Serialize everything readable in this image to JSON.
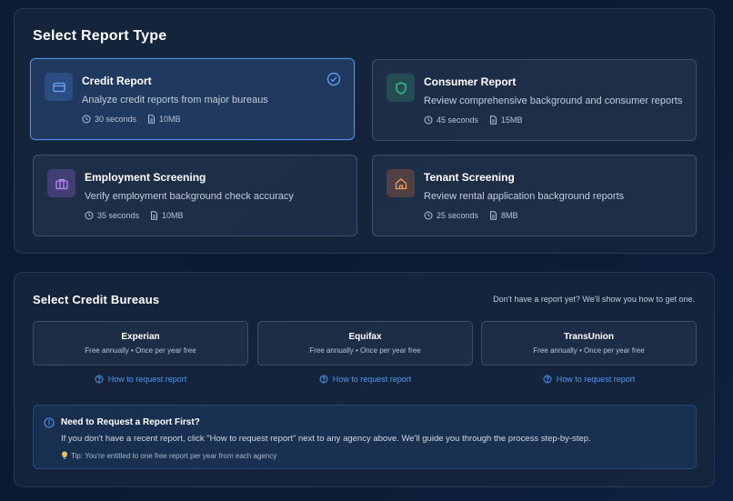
{
  "report_section": {
    "title": "Select Report Type",
    "cards": [
      {
        "title": "Credit Report",
        "desc": "Analyze credit reports from major bureaus",
        "time": "30 seconds",
        "size": "10MB",
        "icon": "credit-card-icon",
        "selected": true,
        "accent": "#5b9cf5"
      },
      {
        "title": "Consumer Report",
        "desc": "Review comprehensive background and consumer reports",
        "time": "45 seconds",
        "size": "15MB",
        "icon": "shield-icon",
        "selected": false,
        "accent": "#3ec98a"
      },
      {
        "title": "Employment Screening",
        "desc": "Verify employment background check accuracy",
        "time": "35 seconds",
        "size": "10MB",
        "icon": "briefcase-icon",
        "selected": false,
        "accent": "#b07cf0"
      },
      {
        "title": "Tenant Screening",
        "desc": "Review rental application background reports",
        "time": "25 seconds",
        "size": "8MB",
        "icon": "home-icon",
        "selected": false,
        "accent": "#f0904a"
      }
    ]
  },
  "bureau_section": {
    "title": "Select Credit Bureaus",
    "subtitle": "Don't have a report yet? We'll show you how to get one.",
    "bureaus": [
      {
        "name": "Experian",
        "sub": "Free annually • Once per year free",
        "link": "How to request report"
      },
      {
        "name": "Equifax",
        "sub": "Free annually • Once per year free",
        "link": "How to request report"
      },
      {
        "name": "TransUnion",
        "sub": "Free annually • Once per year free",
        "link": "How to request report"
      }
    ],
    "notice": {
      "title": "Need to Request a Report First?",
      "body": "If you don't have a recent report, click \"How to request report\" next to any agency above. We'll guide you through the process step-by-step.",
      "tip": "Tip: You're entitled to one free report per year from each agency"
    }
  },
  "colors": {
    "link": "#4f97f5",
    "selected_border": "#4d8ff0"
  }
}
